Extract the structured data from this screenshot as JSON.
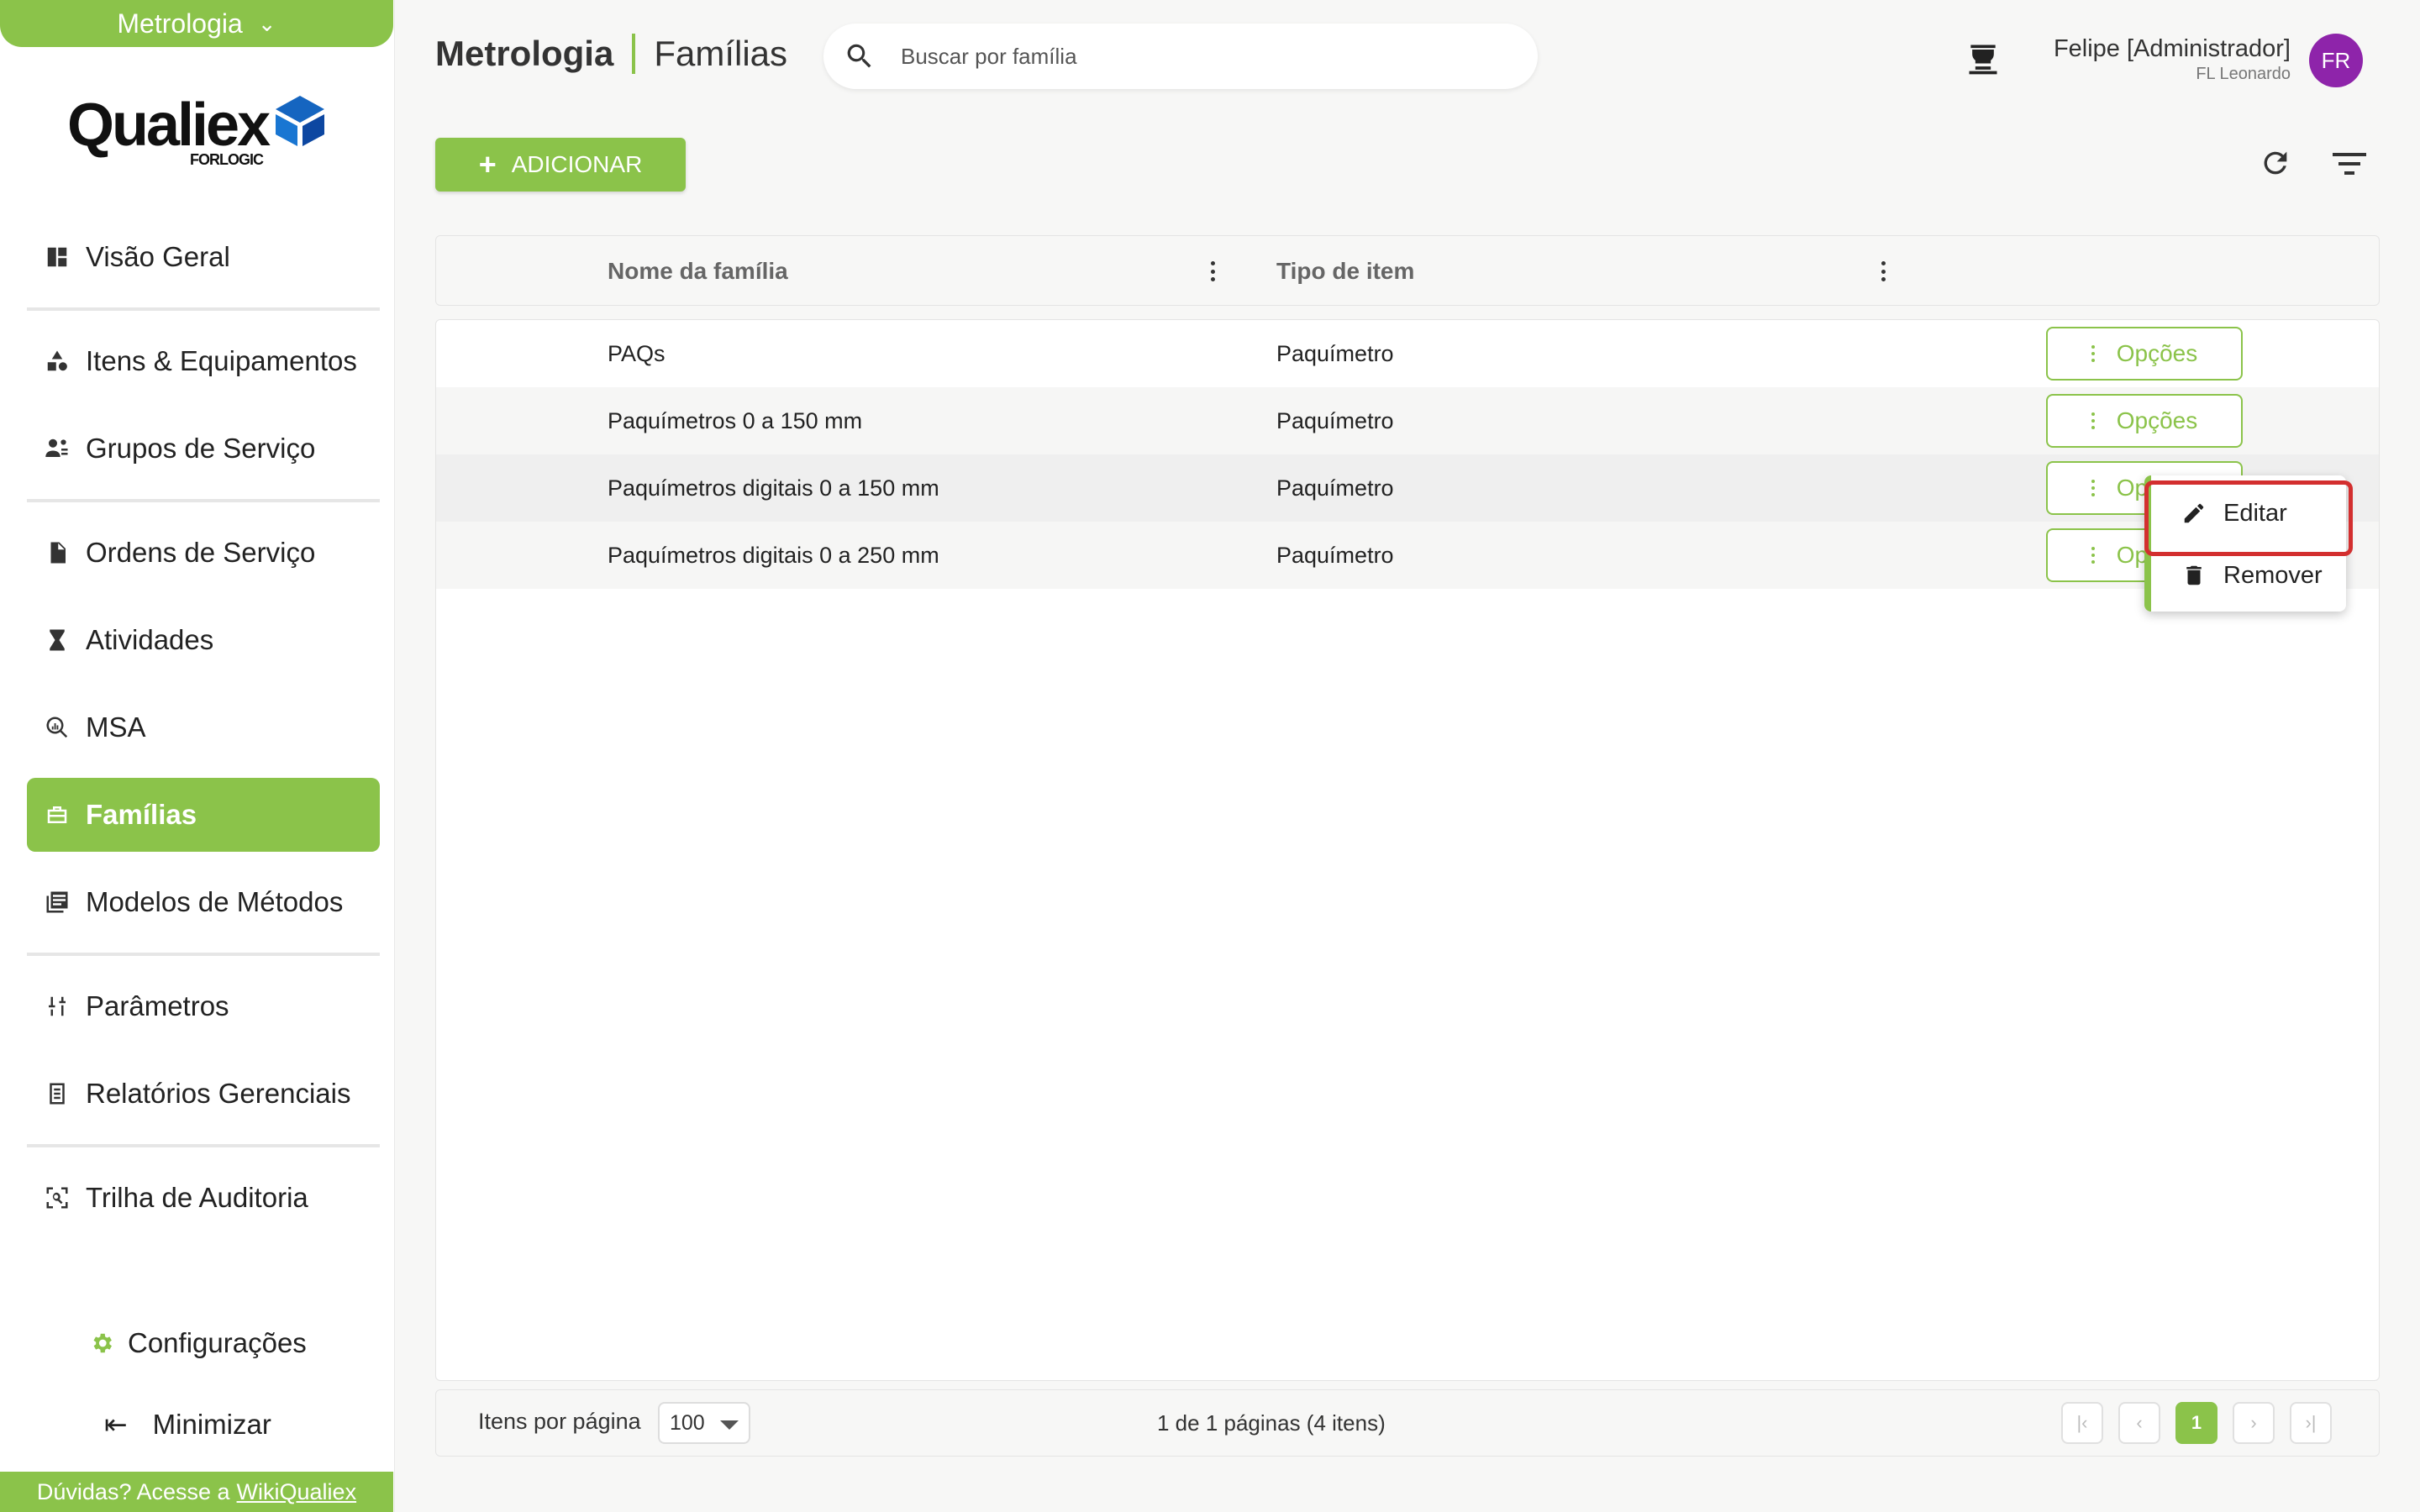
{
  "app": {
    "module": "Metrologia",
    "logo_text": "Qualiex",
    "logo_sub": "FORLOGIC"
  },
  "sidebar": {
    "items": [
      {
        "label": "Visão Geral",
        "icon": "dashboard-icon"
      },
      {
        "label": "Itens & Equipamentos",
        "icon": "shapes-icon"
      },
      {
        "label": "Grupos de Serviço",
        "icon": "group-icon"
      },
      {
        "label": "Ordens de Serviço",
        "icon": "document-icon"
      },
      {
        "label": "Atividades",
        "icon": "hourglass-icon"
      },
      {
        "label": "MSA",
        "icon": "zoom-analytics-icon"
      },
      {
        "label": "Famílias",
        "icon": "toolbox-icon",
        "active": true
      },
      {
        "label": "Modelos de Métodos",
        "icon": "library-icon"
      },
      {
        "label": "Parâmetros",
        "icon": "sliders-icon"
      },
      {
        "label": "Relatórios Gerenciais",
        "icon": "report-icon"
      },
      {
        "label": "Trilha de Auditoria",
        "icon": "audit-scan-icon"
      }
    ],
    "settings_label": "Configurações",
    "minimize_label": "Minimizar",
    "help_text": "Dúvidas? Acesse a",
    "help_link": "WikiQualiex"
  },
  "header": {
    "module": "Metrologia",
    "page": "Famílias",
    "search_placeholder": "Buscar por família",
    "user_name": "Felipe [Administrador]",
    "user_org": "FL Leonardo",
    "avatar_initials": "FR"
  },
  "toolbar": {
    "add_label": "ADICIONAR"
  },
  "table": {
    "columns": [
      "Nome da família",
      "Tipo de item"
    ],
    "rows": [
      {
        "name": "PAQs",
        "type": "Paquímetro",
        "options": "Opções"
      },
      {
        "name": "Paquímetros 0 a 150 mm",
        "type": "Paquímetro",
        "options": "Opções"
      },
      {
        "name": "Paquímetros digitais 0 a 150 mm",
        "type": "Paquímetro",
        "options": "Opções"
      },
      {
        "name": "Paquímetros digitais 0 a 250 mm",
        "type": "Paquímetro",
        "options": "Opções"
      }
    ]
  },
  "menu": {
    "edit_label": "Editar",
    "remove_label": "Remover"
  },
  "footer": {
    "items_per_page_label": "Itens por página",
    "items_per_page_value": "100",
    "page_info": "1 de 1 páginas (4 itens)",
    "current_page": "1"
  },
  "colors": {
    "accent": "#8bc34a",
    "avatar": "#8e24aa",
    "highlight": "#d32f2f"
  }
}
